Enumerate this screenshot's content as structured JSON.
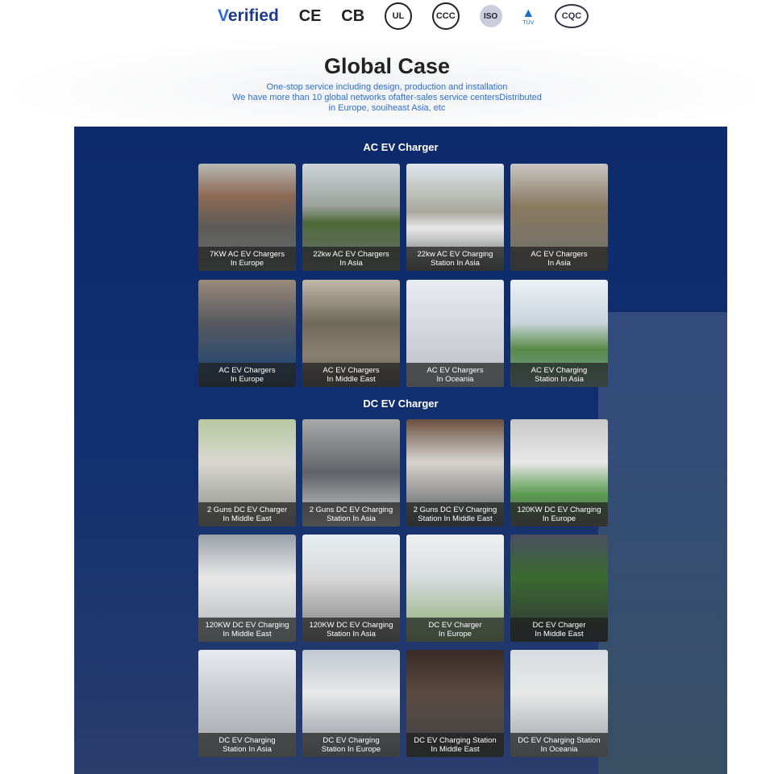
{
  "certifications": [
    "Verified",
    "CE",
    "CB",
    "UL",
    "CCC",
    "ISO",
    "TÜV",
    "CQC"
  ],
  "header": {
    "title": "Global Case",
    "lines": [
      "One-stop service including design, production and installation",
      "We have more than 10 global networks ofafter-sales service centersDistributed",
      "in Europe, souiheast Asia, etc"
    ]
  },
  "ac": {
    "title": "AC EV Charger",
    "items": [
      [
        "7KW AC EV Chargers",
        "In Europe"
      ],
      [
        "22kw AC EV Chargers",
        "In Asia"
      ],
      [
        "22kw AC EV Charging",
        "Station In Asia"
      ],
      [
        "AC EV Chargers",
        "In Asia"
      ],
      [
        "AC EV Chargers",
        "In Europe"
      ],
      [
        "AC EV Chargers",
        "In Middle East"
      ],
      [
        "AC EV Chargers",
        "In Oceania"
      ],
      [
        "AC EV Charging",
        "Station In Asia"
      ]
    ]
  },
  "dc": {
    "title": "DC EV Charger",
    "items": [
      [
        "2 Guns DC EV Charger",
        "In Middle East"
      ],
      [
        "2 Guns DC EV Charging",
        "Station In Asia"
      ],
      [
        "2 Guns DC EV Charging",
        "Station In Middle East"
      ],
      [
        "120KW DC EV Charging",
        "In Europe"
      ],
      [
        "120KW DC EV Charging",
        "In Middle East"
      ],
      [
        "120KW DC EV Charging",
        "Station In Asia"
      ],
      [
        "DC EV Charger",
        "In Europe"
      ],
      [
        "DC EV Charger",
        "In Middle East"
      ],
      [
        "DC EV Charging",
        "Station In Asia"
      ],
      [
        "DC EV Charging",
        "Station In Europe"
      ],
      [
        "DC EV Charging Station",
        "In Middle East"
      ],
      [
        "DC EV Charging Station",
        "In Oceania"
      ]
    ]
  }
}
